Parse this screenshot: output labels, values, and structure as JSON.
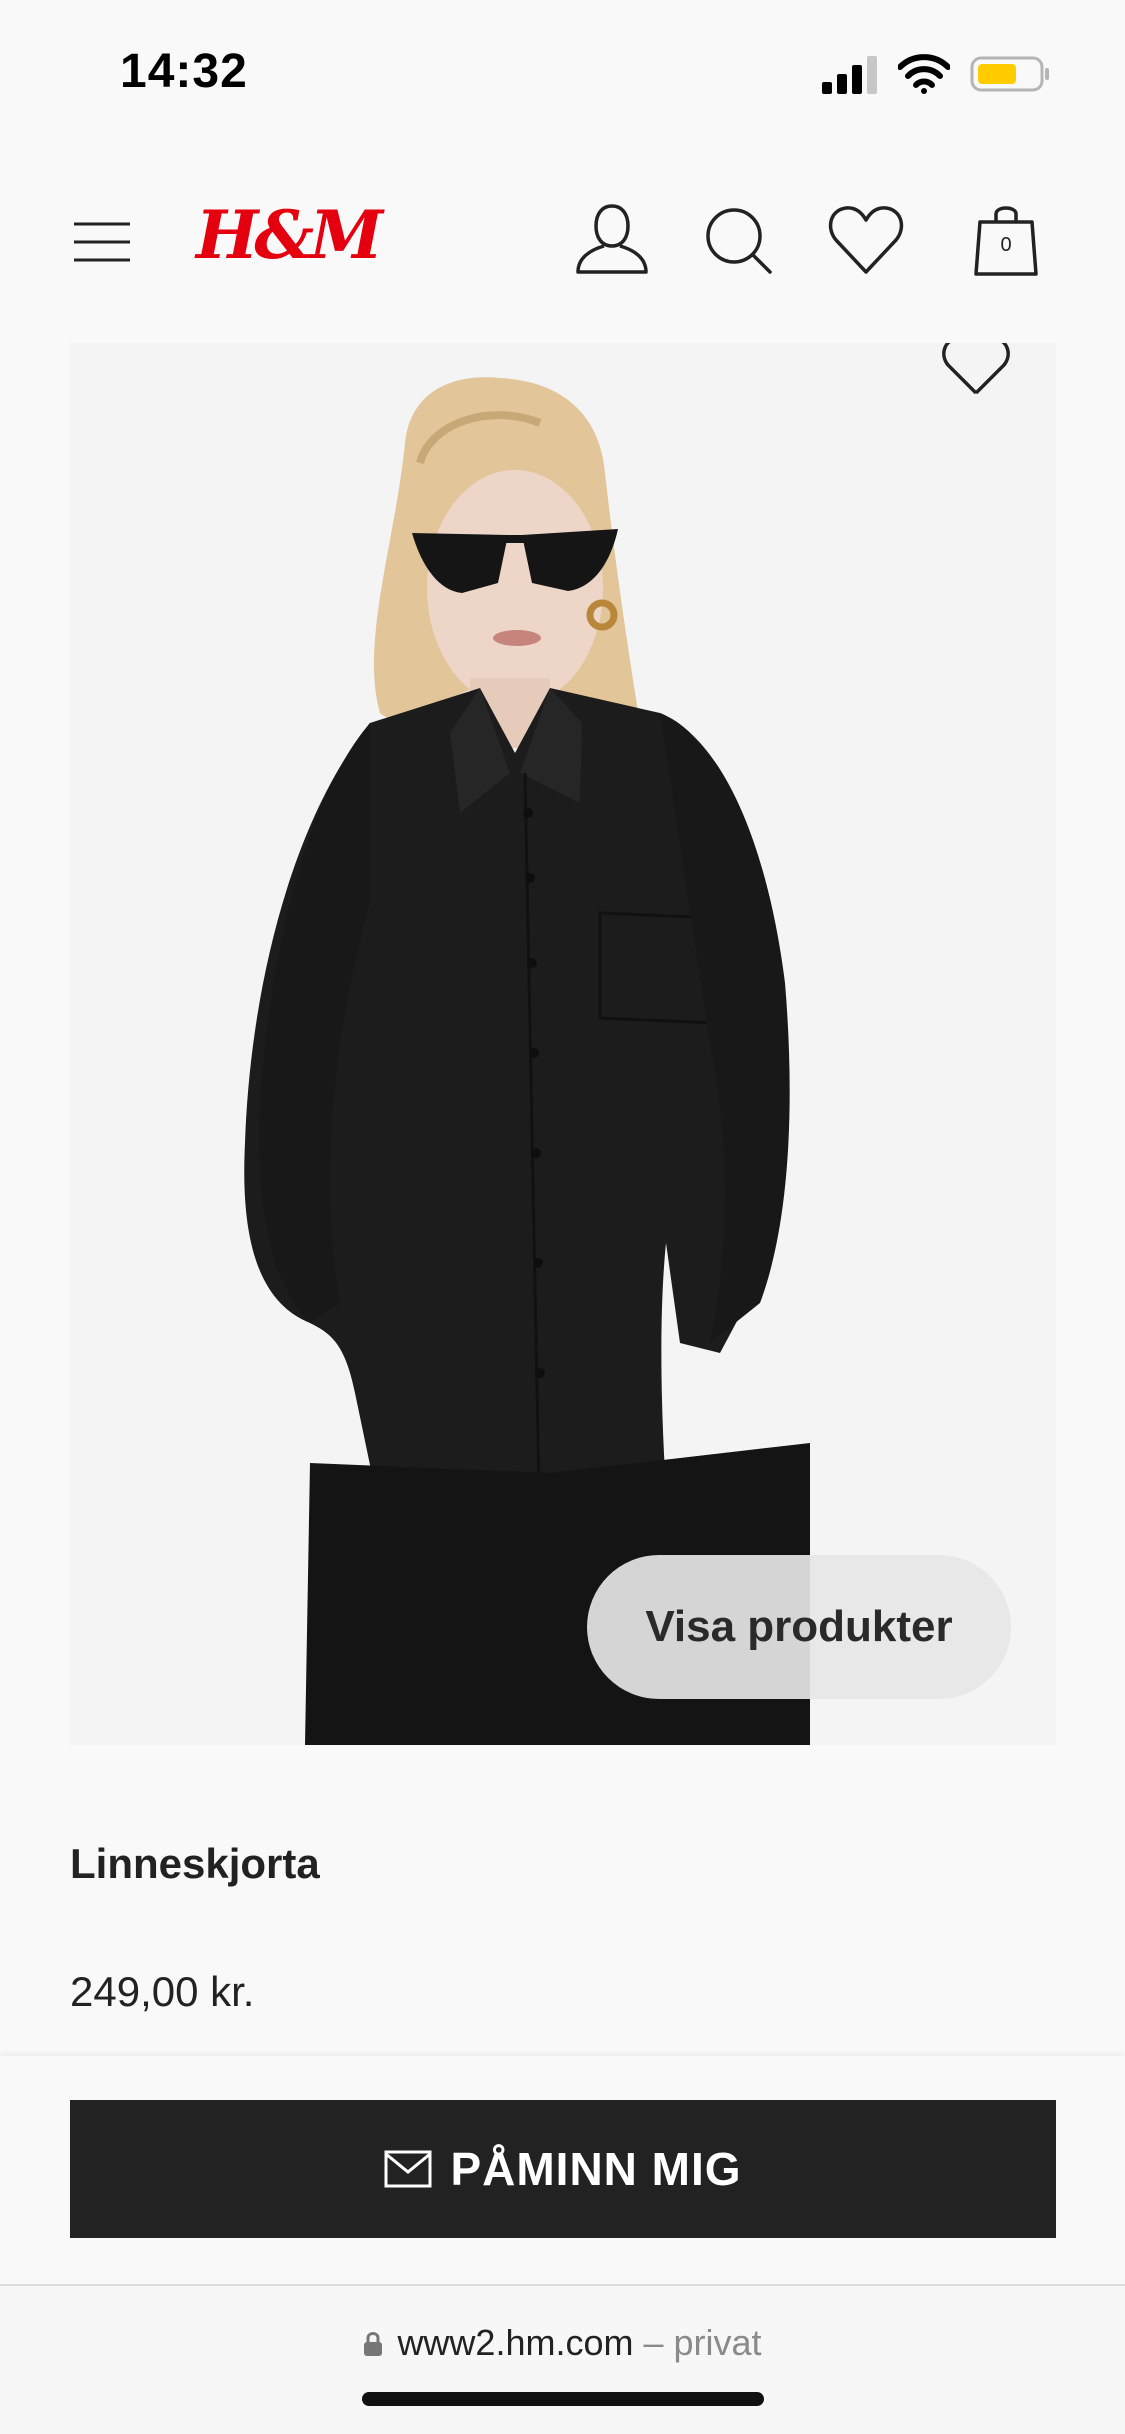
{
  "status_bar": {
    "time": "14:32",
    "icons": [
      "cellular-signal-icon",
      "wifi-icon",
      "battery-icon"
    ],
    "battery_color": "#ffcc00"
  },
  "header": {
    "logo_text": "H&M",
    "logo_color": "#e50010",
    "icons": [
      "menu-icon",
      "account-icon",
      "search-icon",
      "wishlist-icon",
      "shopping-bag-icon"
    ],
    "bag_count": "0"
  },
  "product": {
    "image_icon": "favorite-heart-icon",
    "show_products_label": "Visa produkter",
    "name": "Linneskjorta",
    "price": "249,00 kr."
  },
  "action": {
    "remind_label": "PÅMINN MIG",
    "icon": "mail-icon"
  },
  "browser": {
    "url": "www2.hm.com",
    "mode": " – privat",
    "icon": "lock-icon"
  }
}
